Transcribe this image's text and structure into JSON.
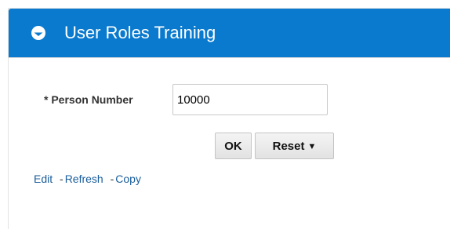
{
  "header": {
    "title": "User Roles Training",
    "icon": "collapse-icon",
    "background": "#0a7ace"
  },
  "form": {
    "person_number_label": "* Person Number",
    "person_number_value": "10000"
  },
  "buttons": {
    "ok_label": "OK",
    "reset_label": "Reset",
    "reset_caret": "▼"
  },
  "links": {
    "edit": "Edit",
    "refresh": "Refresh",
    "copy": "Copy",
    "separator": "-",
    "link_color": "#1a5d9c"
  }
}
